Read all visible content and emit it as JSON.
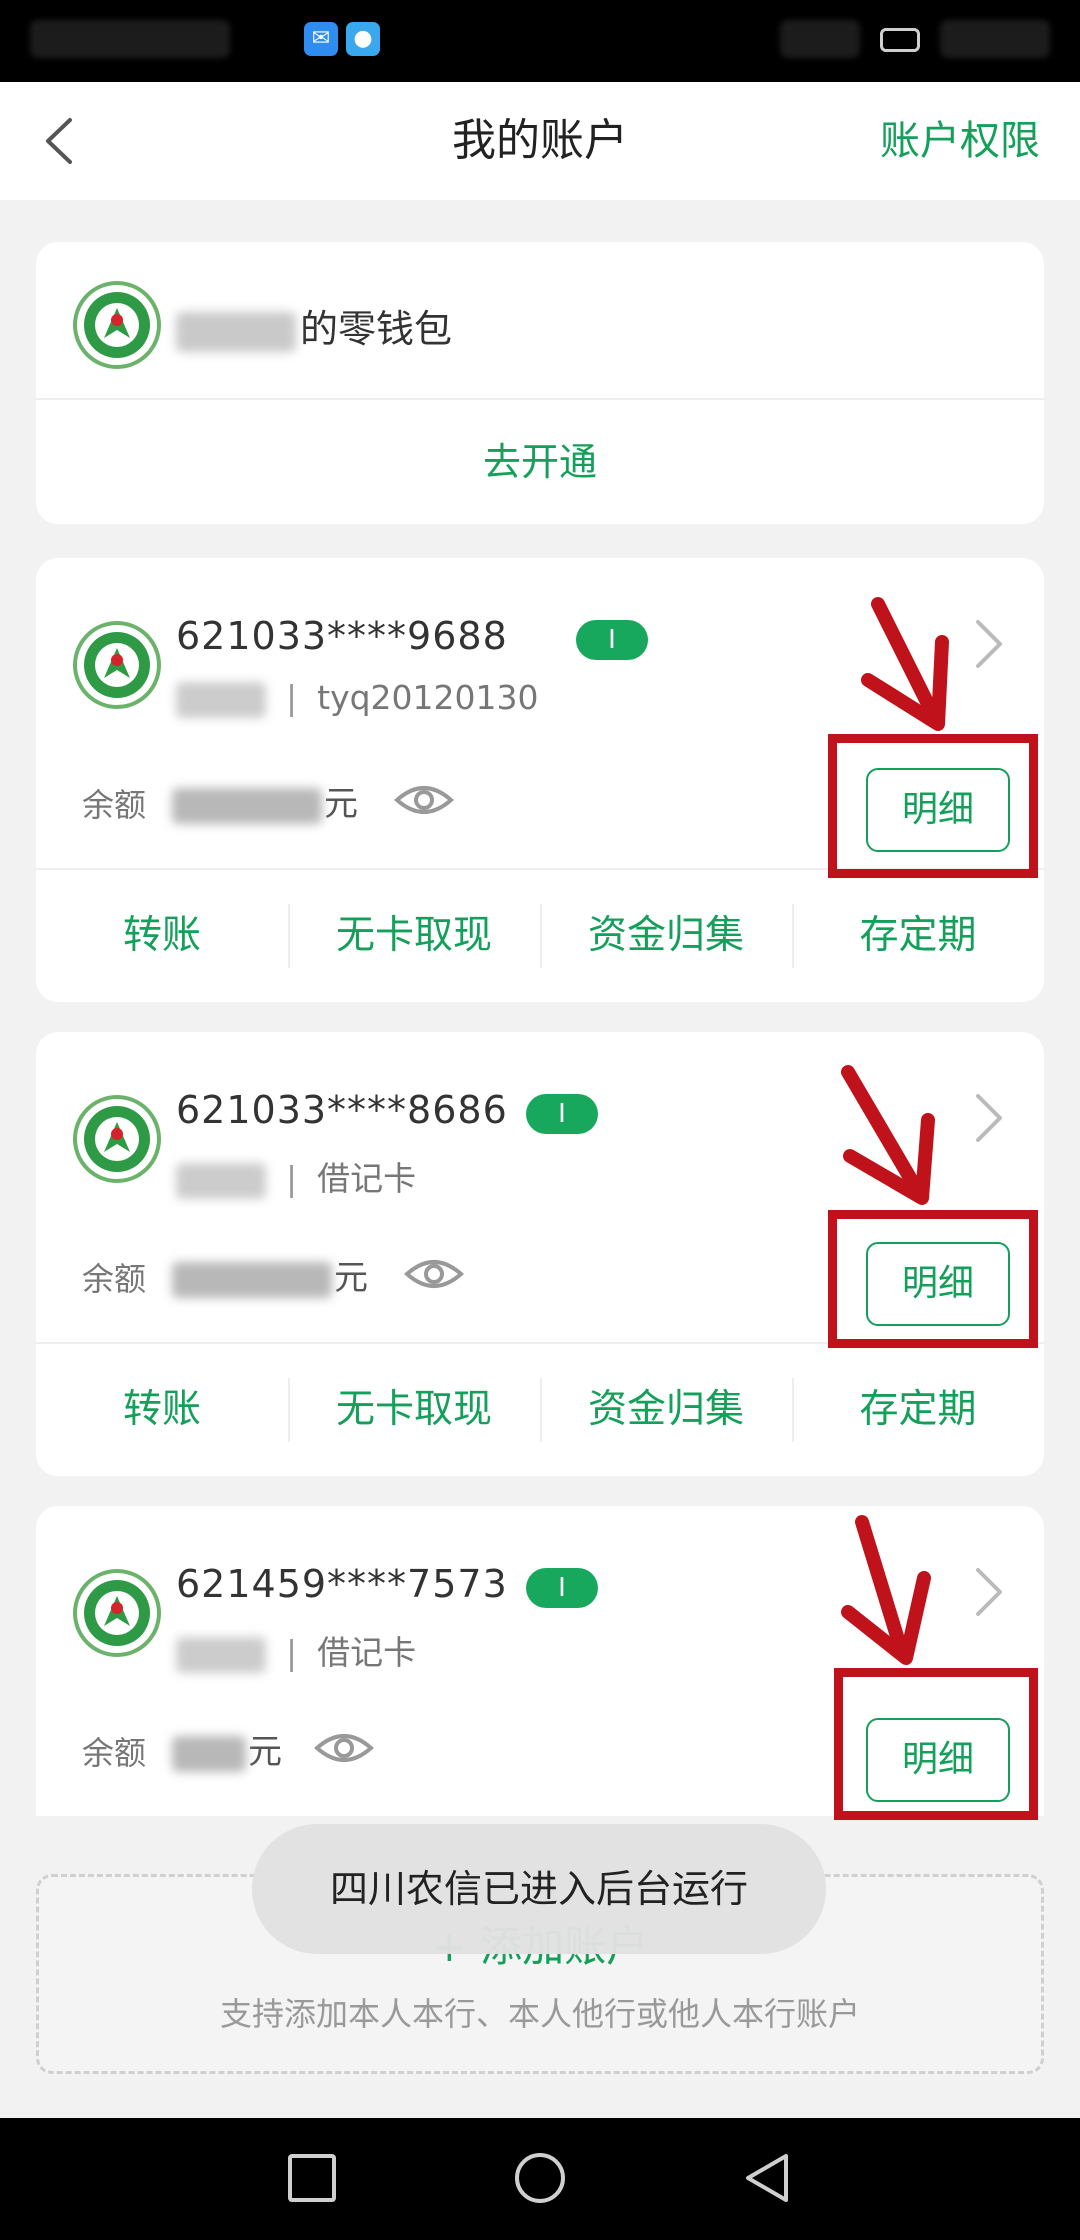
{
  "header": {
    "title": "我的账户",
    "right_link": "账户权限"
  },
  "wallet": {
    "name_suffix": "的零钱包",
    "open_label": "去开通"
  },
  "accounts": [
    {
      "number": "621033****9688",
      "sub_text": "tyq20120130",
      "balance_label": "余额",
      "balance_unit": "元",
      "detail_label": "明细",
      "actions": [
        "转账",
        "无卡取现",
        "资金归集",
        "存定期"
      ]
    },
    {
      "number": "621033****8686",
      "sub_text": "借记卡",
      "balance_label": "余额",
      "balance_unit": "元",
      "detail_label": "明细",
      "actions": [
        "转账",
        "无卡取现",
        "资金归集",
        "存定期"
      ]
    },
    {
      "number": "621459****7573",
      "sub_text": "借记卡",
      "balance_label": "余额",
      "balance_unit": "元",
      "detail_label": "明细"
    }
  ],
  "add_account": {
    "label": "+ 添加账户",
    "hint": "支持添加本人本行、本人他行或他人本行账户"
  },
  "toast": {
    "message": "四川农信已进入后台运行"
  },
  "colors": {
    "accent": "#14a05a",
    "annotation_red": "#c0121a"
  },
  "icons": {
    "back": "back-chevron-icon",
    "bank_logo": "bank-logo-icon",
    "eye": "eye-icon",
    "chevron": "chevron-right-icon",
    "nav_recent": "square-icon",
    "nav_home": "circle-icon",
    "nav_back": "triangle-back-icon"
  }
}
